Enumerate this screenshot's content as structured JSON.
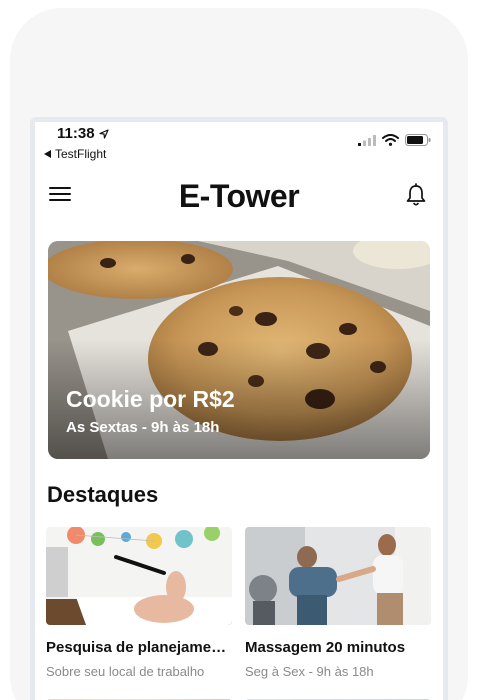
{
  "status_bar": {
    "time": "11:38",
    "back_label": "TestFlight"
  },
  "header": {
    "title": "E-Tower"
  },
  "hero": {
    "title": "Cookie por R$2",
    "subtitle": "As Sextas - 9h às 18h"
  },
  "highlights": {
    "title": "Destaques",
    "cards": [
      {
        "title": "Pesquisa de planejamento",
        "subtitle": "Sobre seu local de trabalho"
      },
      {
        "title": "Massagem 20 minutos",
        "subtitle": "Seg à Sex - 9h às 18h"
      }
    ]
  },
  "colors": {
    "text": "#111111",
    "muted": "#8a8a8a",
    "background": "#ffffff",
    "frame": "#f6f6f6"
  }
}
